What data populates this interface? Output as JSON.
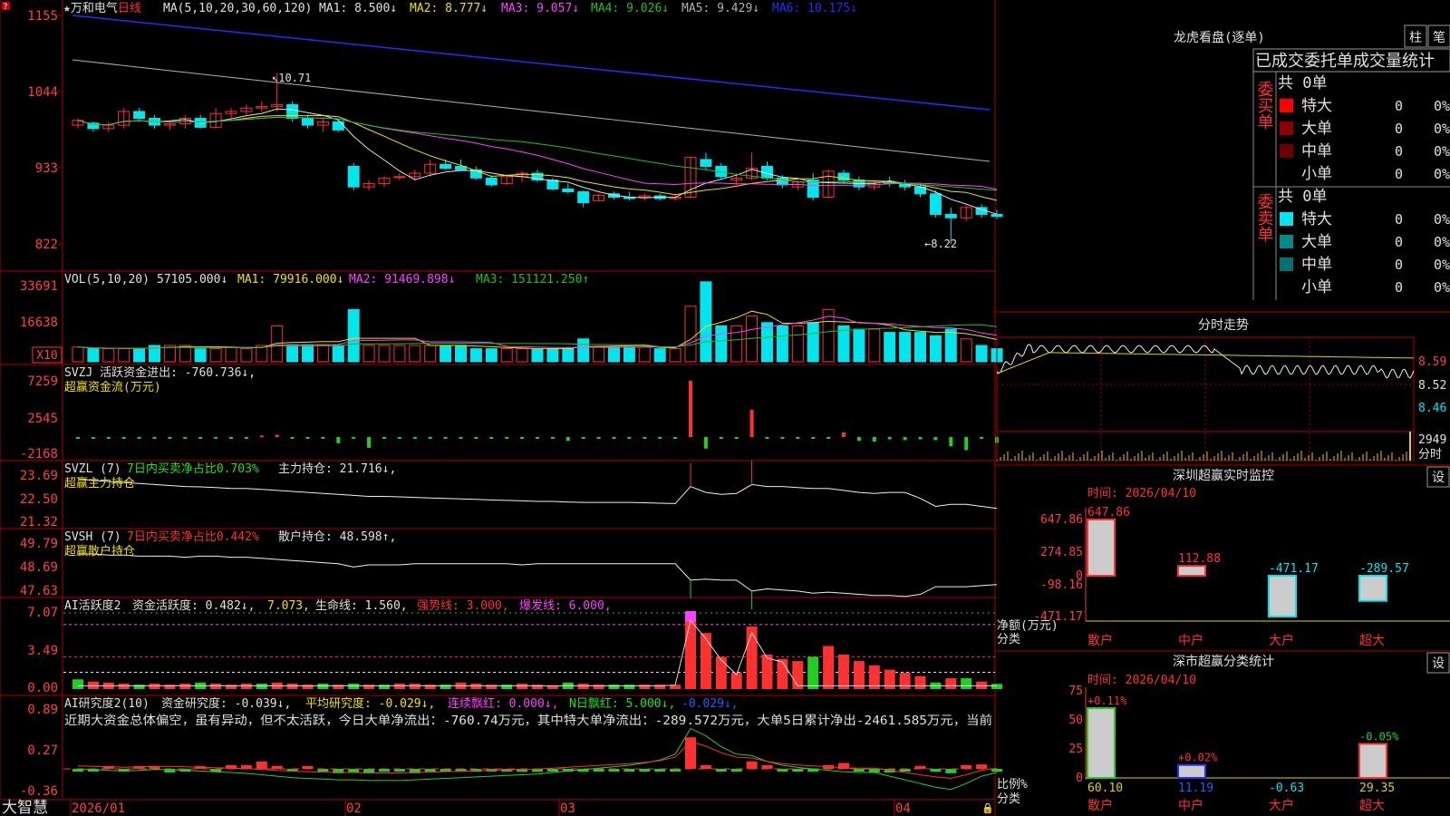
{
  "colors": {
    "up": "#ff3030",
    "down": "#00e5ee",
    "ma1": "#e0e0e0",
    "ma2": "#f0e000",
    "ma3": "#ff40ff",
    "ma4": "#20c020",
    "ma5": "#b0b0b0",
    "ma6": "#1e30ff",
    "frame": "#b00000",
    "axis_text": "#ff4040"
  },
  "header": {
    "star": "★",
    "stock_name": "万和电气",
    "period": "日线",
    "ma_params": "MA(5,10,20,30,60,120)",
    "ma1": "MA1: 8.500↓",
    "ma2": "MA2: 8.777↓",
    "ma3": "MA3: 9.057↓",
    "ma4": "MA4: 9.026↓",
    "ma5": "MA5: 9.429↓",
    "ma6": "MA6: 10.175↓"
  },
  "main_axis": {
    "ticks": [
      "1155",
      "1044",
      "933",
      "822"
    ],
    "high_label": "10.71",
    "low_label": "8.22"
  },
  "vol": {
    "title": "VOL(5,10,20)",
    "value": "57105.000↓",
    "ma1": "MA1: 79916.000↓",
    "ma2": "MA2: 91469.898↓",
    "ma3": "MA3: 151121.250↑",
    "ticks": [
      "33691",
      "16638"
    ],
    "unit": "X10"
  },
  "svzj": {
    "title": "SVZJ  活跃资金进出: -760.736↓,",
    "subtitle": "超赢资金流(万元)",
    "ticks": [
      "7259",
      "2545",
      "-2168"
    ]
  },
  "svzl": {
    "title": "SVZL (7)",
    "t2": "7日内买卖净占比0.703%",
    "t3": "主力持仓: 21.716↓,",
    "subtitle": "超赢主力持仓",
    "ticks": [
      "23.69",
      "22.50",
      "21.32"
    ]
  },
  "svsh": {
    "title": "SVSH (7)",
    "t2": "7日内买卖净占比0.442%",
    "t3": "散户持仓: 48.598↑,",
    "subtitle": "超赢散户持仓",
    "ticks": [
      "49.79",
      "48.69",
      "47.63"
    ]
  },
  "ai1": {
    "title": "AI活跃度2",
    "t2": "资金活跃度: 0.482↓,",
    "t3": "7.073,",
    "t4": "生命线: 1.560,",
    "t5": "强势线: 3.000,",
    "t6": "爆发线: 6.000,",
    "ticks": [
      "7.07",
      "3.49",
      "0.00"
    ]
  },
  "ai2": {
    "title": "AI研究度2(10)",
    "t2": "资金研究度: -0.039↓,",
    "t3": "平均研究度: -0.029↓,",
    "t4": "连续飘红: 0.000↓,",
    "t5": "N日飘红: 5.000↓,",
    "t6": "-0.029↓,",
    "comment": "近期大资金总体偏空，虽有异动，但不太活跃，今日大单净流出：-760.74万元，其中特大单净流出：-289.572万元，大单5日累计净出-2461.585万元，当前",
    "ticks": [
      "0.89",
      "0.27",
      "-0.36"
    ]
  },
  "date_axis": {
    "labels": [
      "2026/01",
      "02",
      "03",
      "04"
    ]
  },
  "footer": {
    "app_name": "大智慧"
  },
  "dragon": {
    "title": "龙虎看盘(逐单)",
    "btn1": "柱",
    "btn2": "笔",
    "tabs": [
      "已成交",
      "委托单",
      "成交量统计"
    ],
    "buy": {
      "side_label": "委买单",
      "total": "共 0单",
      "rows": [
        {
          "label": "特大",
          "count": "0",
          "pct": "0%"
        },
        {
          "label": "大单",
          "count": "0",
          "pct": "0%"
        },
        {
          "label": "中单",
          "count": "0",
          "pct": "0%"
        },
        {
          "label": "小单",
          "count": "0",
          "pct": "0%"
        }
      ]
    },
    "sell": {
      "side_label": "委卖单",
      "total": "共 0单",
      "rows": [
        {
          "label": "特大",
          "count": "0",
          "pct": "0%"
        },
        {
          "label": "大单",
          "count": "0",
          "pct": "0%"
        },
        {
          "label": "中单",
          "count": "0",
          "pct": "0%"
        },
        {
          "label": "小单",
          "count": "0",
          "pct": "0%"
        }
      ]
    }
  },
  "intraday": {
    "title": "分时走势",
    "ticks": [
      "8.59",
      "8.52",
      "8.46"
    ],
    "vol_tick": "2949",
    "vol_unit": "分时"
  },
  "sz_monitor": {
    "title": "深圳超赢实时监控",
    "settings": "设",
    "time": "时间: 2026/04/10",
    "ticks": [
      "647.86",
      "274.85",
      "0",
      "-98.16",
      "-471.17"
    ],
    "y_caption1": "净额(万元)",
    "y_caption2": "分类",
    "categories": [
      "散户",
      "中户",
      "大户",
      "超大"
    ],
    "values": [
      647.86,
      112.88,
      -471.17,
      -289.57
    ],
    "value_labels": [
      "647.86",
      "112.88",
      "-471.17",
      "-289.57"
    ]
  },
  "sz_class": {
    "title": "深市超赢分类统计",
    "settings": "设",
    "time": "时间: 2026/04/10",
    "ticks": [
      "75",
      "50",
      "25",
      "0"
    ],
    "y_caption1": "比例%",
    "y_caption2": "分类",
    "categories": [
      "散户",
      "中户",
      "大户",
      "超大"
    ],
    "values": [
      60.1,
      11.19,
      -0.63,
      29.35
    ],
    "value_labels": [
      "60.10",
      "11.19",
      "-0.63",
      "29.35"
    ],
    "change_labels": [
      "+0.11%",
      "+0.02%",
      "",
      "-0.05%"
    ]
  },
  "chart_data": [
    {
      "type": "candlestick",
      "title": "万和电气 日线",
      "x_labels": [
        "2026/01",
        "02",
        "03",
        "04"
      ],
      "ohlc": [
        [
          9.95,
          10.05,
          9.9,
          10.02
        ],
        [
          9.98,
          10.0,
          9.85,
          9.9
        ],
        [
          9.9,
          10.0,
          9.85,
          9.95
        ],
        [
          9.95,
          10.2,
          9.9,
          10.15
        ],
        [
          10.15,
          10.2,
          10.0,
          10.05
        ],
        [
          10.05,
          10.1,
          9.9,
          9.95
        ],
        [
          9.95,
          10.0,
          9.88,
          9.97
        ],
        [
          9.97,
          10.1,
          9.9,
          10.05
        ],
        [
          10.05,
          10.1,
          9.9,
          9.92
        ],
        [
          9.92,
          10.2,
          9.9,
          10.12
        ],
        [
          10.12,
          10.2,
          10.05,
          10.15
        ],
        [
          10.15,
          10.25,
          10.1,
          10.2
        ],
        [
          10.2,
          10.3,
          10.15,
          10.22
        ],
        [
          10.22,
          10.71,
          10.15,
          10.25
        ],
        [
          10.25,
          10.3,
          10.0,
          10.05
        ],
        [
          10.05,
          10.1,
          9.9,
          9.95
        ],
        [
          9.95,
          10.05,
          9.85,
          10.0
        ],
        [
          10.0,
          10.05,
          9.85,
          9.88
        ],
        [
          9.35,
          9.4,
          9.0,
          9.05
        ],
        [
          9.05,
          9.15,
          9.0,
          9.1
        ],
        [
          9.1,
          9.2,
          9.05,
          9.18
        ],
        [
          9.2,
          9.25,
          9.15,
          9.2
        ],
        [
          9.2,
          9.3,
          9.15,
          9.25
        ],
        [
          9.25,
          9.45,
          9.2,
          9.38
        ],
        [
          9.38,
          9.45,
          9.3,
          9.32
        ],
        [
          9.35,
          9.45,
          9.28,
          9.3
        ],
        [
          9.3,
          9.35,
          9.15,
          9.18
        ],
        [
          9.18,
          9.22,
          9.05,
          9.08
        ],
        [
          9.1,
          9.22,
          9.08,
          9.2
        ],
        [
          9.2,
          9.28,
          9.12,
          9.25
        ],
        [
          9.25,
          9.3,
          9.12,
          9.15
        ],
        [
          9.15,
          9.18,
          9.0,
          9.02
        ],
        [
          9.02,
          9.1,
          8.95,
          8.98
        ],
        [
          8.98,
          9.0,
          8.75,
          8.82
        ],
        [
          8.85,
          8.95,
          8.85,
          8.93
        ],
        [
          8.95,
          8.98,
          8.87,
          8.9
        ],
        [
          8.9,
          8.98,
          8.85,
          8.88
        ],
        [
          8.9,
          8.95,
          8.85,
          8.92
        ],
        [
          8.92,
          8.95,
          8.85,
          8.88
        ],
        [
          8.88,
          8.95,
          8.85,
          8.9
        ],
        [
          8.9,
          9.5,
          8.88,
          9.48
        ],
        [
          9.45,
          9.55,
          9.3,
          9.35
        ],
        [
          9.35,
          9.4,
          9.15,
          9.2
        ],
        [
          9.15,
          9.25,
          9.08,
          9.18
        ],
        [
          9.18,
          9.55,
          9.15,
          9.32
        ],
        [
          9.35,
          9.42,
          9.15,
          9.18
        ],
        [
          9.18,
          9.22,
          9.03,
          9.08
        ],
        [
          9.05,
          9.15,
          9.0,
          9.12
        ],
        [
          9.15,
          9.25,
          8.85,
          8.9
        ],
        [
          8.9,
          9.3,
          8.88,
          9.28
        ],
        [
          9.25,
          9.3,
          9.1,
          9.15
        ],
        [
          9.15,
          9.2,
          9.0,
          9.05
        ],
        [
          9.05,
          9.15,
          9.0,
          9.12
        ],
        [
          9.12,
          9.2,
          9.05,
          9.1
        ],
        [
          9.1,
          9.15,
          9.0,
          9.05
        ],
        [
          9.05,
          9.1,
          8.9,
          8.95
        ],
        [
          8.95,
          9.0,
          8.6,
          8.65
        ],
        [
          8.65,
          8.75,
          8.22,
          8.6
        ],
        [
          8.6,
          8.78,
          8.55,
          8.75
        ],
        [
          8.75,
          8.8,
          8.6,
          8.65
        ],
        [
          8.65,
          8.72,
          8.58,
          8.62
        ]
      ],
      "ylim": [
        8.0,
        11.6
      ]
    },
    {
      "type": "bar",
      "title": "VOL",
      "values": [
        9,
        8,
        8,
        8,
        8,
        10,
        10,
        10,
        8,
        8,
        9,
        8,
        10,
        22,
        10,
        10,
        10,
        10,
        32,
        10,
        10,
        10,
        10,
        10,
        10,
        10,
        8,
        8,
        8,
        8,
        8,
        8,
        8,
        14,
        9,
        9,
        9,
        9,
        8,
        8,
        34,
        49,
        22,
        22,
        28,
        24,
        22,
        22,
        24,
        32,
        22,
        20,
        20,
        18,
        18,
        18,
        16,
        20,
        14,
        10,
        8
      ],
      "ylim": [
        0,
        50000
      ],
      "unit": "X10"
    },
    {
      "type": "bar",
      "title": "SVZJ 活跃资金进出",
      "values": [
        -80,
        -70,
        -80,
        -60,
        -70,
        -70,
        -90,
        -90,
        -70,
        -40,
        -50,
        -60,
        200,
        300,
        -100,
        -90,
        -90,
        -800,
        -60,
        -1400,
        -60,
        -90,
        -80,
        -70,
        -60,
        -60,
        -90,
        -50,
        -70,
        -60,
        -60,
        -60,
        -500,
        -70,
        -60,
        -70,
        -60,
        -60,
        -50,
        -50,
        7259,
        -1500,
        -70,
        -60,
        3500,
        -70,
        -70,
        -70,
        -80,
        -100,
        600,
        -500,
        -600,
        -300,
        -400,
        -300,
        -400,
        -1200,
        -1700,
        -80,
        -761
      ],
      "ylim": [
        -2168,
        7259
      ]
    },
    {
      "type": "line",
      "title": "SVZL 主力持仓",
      "ylim": [
        21.32,
        23.69
      ]
    },
    {
      "type": "line",
      "title": "SVSH 散户持仓",
      "ylim": [
        47.63,
        49.79
      ]
    },
    {
      "type": "bar",
      "title": "AI活跃度2",
      "ylim": [
        0,
        7.07
      ]
    },
    {
      "type": "bar",
      "title": "AI研究度2(10)",
      "ylim": [
        -0.36,
        0.89
      ]
    },
    {
      "type": "bar",
      "title": "深圳超赢实时监控",
      "categories": [
        "散户",
        "中户",
        "大户",
        "超大"
      ],
      "values": [
        647.86,
        112.88,
        -471.17,
        -289.57
      ],
      "ylim": [
        -471.17,
        647.86
      ]
    },
    {
      "type": "bar",
      "title": "深市超赢分类统计",
      "categories": [
        "散户",
        "中户",
        "大户",
        "超大"
      ],
      "values": [
        60.1,
        11.19,
        -0.63,
        29.35
      ],
      "ylim": [
        0,
        75
      ]
    }
  ]
}
